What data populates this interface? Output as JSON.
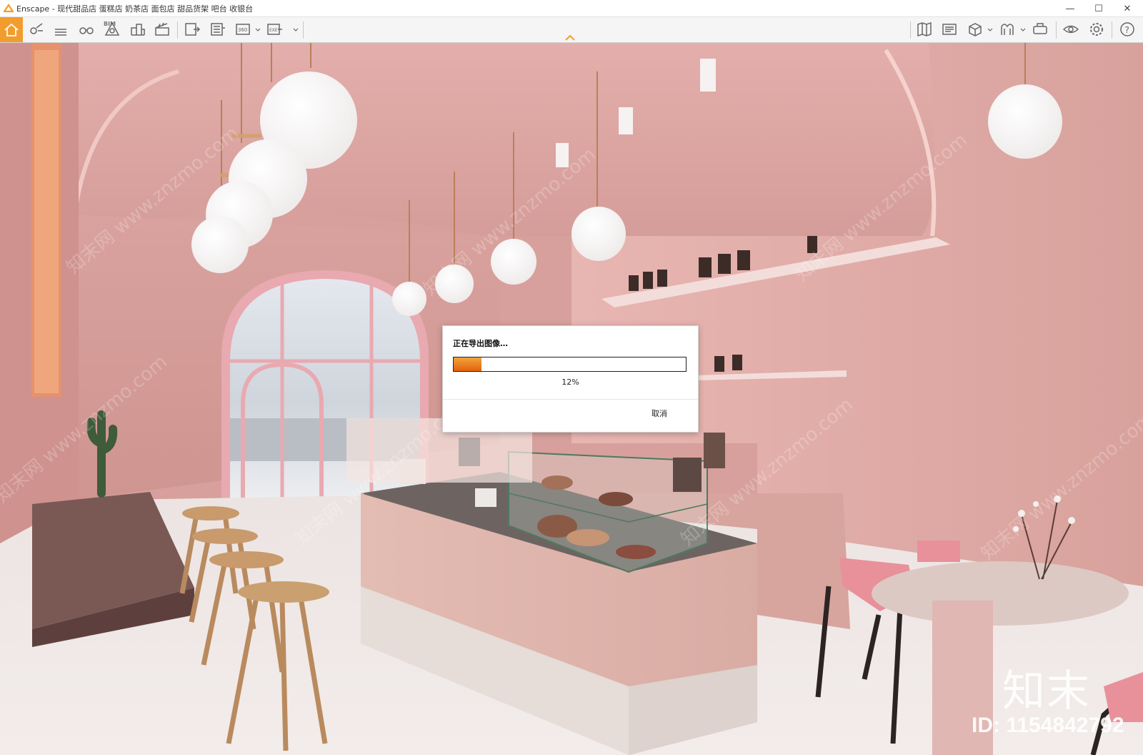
{
  "window": {
    "title": "Enscape - 现代甜品店 蛋糕店 奶茶店 面包店 甜品货架 吧台 收银台",
    "minimize": "—",
    "maximize": "☐",
    "close": "✕"
  },
  "toolbar": {
    "bim_label": "BIM",
    "accent_color": "#f39c2e",
    "left_icons": [
      "home-icon",
      "view-position-icon",
      "bim-icon",
      "binoculars-icon",
      "atmosphere-icon",
      "asset-library-icon",
      "video-editor-icon",
      "screenshot-icon",
      "batch-render-icon",
      "panorama-icon",
      "export-exe-icon"
    ],
    "right_icons": [
      "map-icon",
      "visual-settings-icon",
      "view-mode-icon",
      "sun-icon",
      "vr-headset-icon",
      "eye-icon",
      "settings-icon",
      "help-icon"
    ]
  },
  "dialog": {
    "title": "正在导出图像…",
    "progress_value": 0.12,
    "progress_text": "12%",
    "cancel_label": "取消",
    "bar_color": "#e8731a"
  },
  "watermark": {
    "brand": "知末",
    "id_text": "ID: 1154842792",
    "diagonal": "知末网 www.znzmo.com"
  }
}
